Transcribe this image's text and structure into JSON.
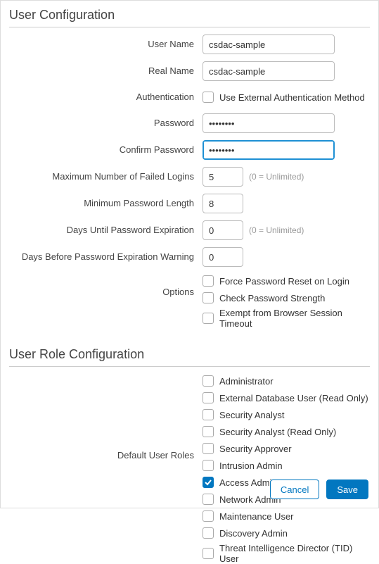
{
  "section1": {
    "title": "User Configuration",
    "labels": {
      "userName": "User Name",
      "realName": "Real Name",
      "authentication": "Authentication",
      "password": "Password",
      "confirmPassword": "Confirm Password",
      "maxFailed": "Maximum Number of Failed Logins",
      "minPwdLen": "Minimum Password Length",
      "daysExpire": "Days Until Password Expiration",
      "daysWarn": "Days Before Password Expiration Warning",
      "options": "Options"
    },
    "values": {
      "userName": "csdac-sample",
      "realName": "csdac-sample",
      "password": "••••••••",
      "confirmPassword": "••••••••",
      "maxFailed": "5",
      "minPwdLen": "8",
      "daysExpire": "0",
      "daysWarn": "0"
    },
    "hints": {
      "unlimited": "(0 = Unlimited)"
    },
    "authCheckbox": {
      "label": "Use External Authentication Method",
      "checked": false
    },
    "optionCheckboxes": [
      {
        "label": "Force Password Reset on Login",
        "checked": false
      },
      {
        "label": "Check Password Strength",
        "checked": false
      },
      {
        "label": "Exempt from Browser Session Timeout",
        "checked": false
      }
    ]
  },
  "section2": {
    "title": "User Role Configuration",
    "label": "Default User Roles",
    "roles": [
      {
        "label": "Administrator",
        "checked": false
      },
      {
        "label": "External Database User (Read Only)",
        "checked": false
      },
      {
        "label": "Security Analyst",
        "checked": false
      },
      {
        "label": "Security Analyst (Read Only)",
        "checked": false
      },
      {
        "label": "Security Approver",
        "checked": false
      },
      {
        "label": "Intrusion Admin",
        "checked": false
      },
      {
        "label": "Access Admin",
        "checked": true
      },
      {
        "label": "Network Admin",
        "checked": false
      },
      {
        "label": "Maintenance User",
        "checked": false
      },
      {
        "label": "Discovery Admin",
        "checked": false
      },
      {
        "label": "Threat Intelligence Director (TID) User",
        "checked": false
      }
    ]
  },
  "footer": {
    "cancel": "Cancel",
    "save": "Save"
  }
}
